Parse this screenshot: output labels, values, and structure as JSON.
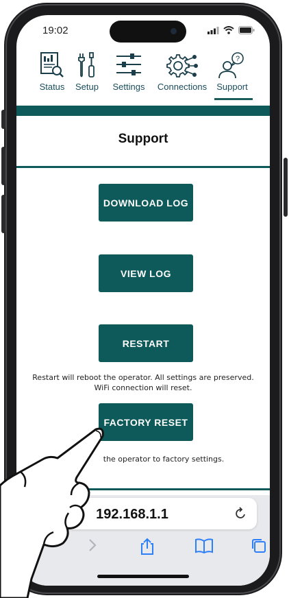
{
  "status_bar": {
    "time": "19:02"
  },
  "nav": {
    "items": [
      {
        "label": "Status",
        "icon": "status-report-icon"
      },
      {
        "label": "Setup",
        "icon": "tools-icon"
      },
      {
        "label": "Settings",
        "icon": "sliders-icon"
      },
      {
        "label": "Connections",
        "icon": "connections-gear-icon"
      },
      {
        "label": "Support",
        "icon": "support-person-icon",
        "active": true
      }
    ]
  },
  "page": {
    "title": "Support",
    "buttons": {
      "download_log": "DOWNLOAD LOG",
      "view_log": "VIEW LOG",
      "restart": "RESTART",
      "factory_reset": "FACTORY RESET"
    },
    "restart_note_1": "Restart will reboot the operator. All settings are preserved.",
    "restart_note_2": "WiFi connection will reset.",
    "factory_note": "the operator to factory settings."
  },
  "browser": {
    "url": "192.168.1.1"
  },
  "colors": {
    "accent": "#0e5a5a",
    "nav_text": "#1a4d5c"
  }
}
